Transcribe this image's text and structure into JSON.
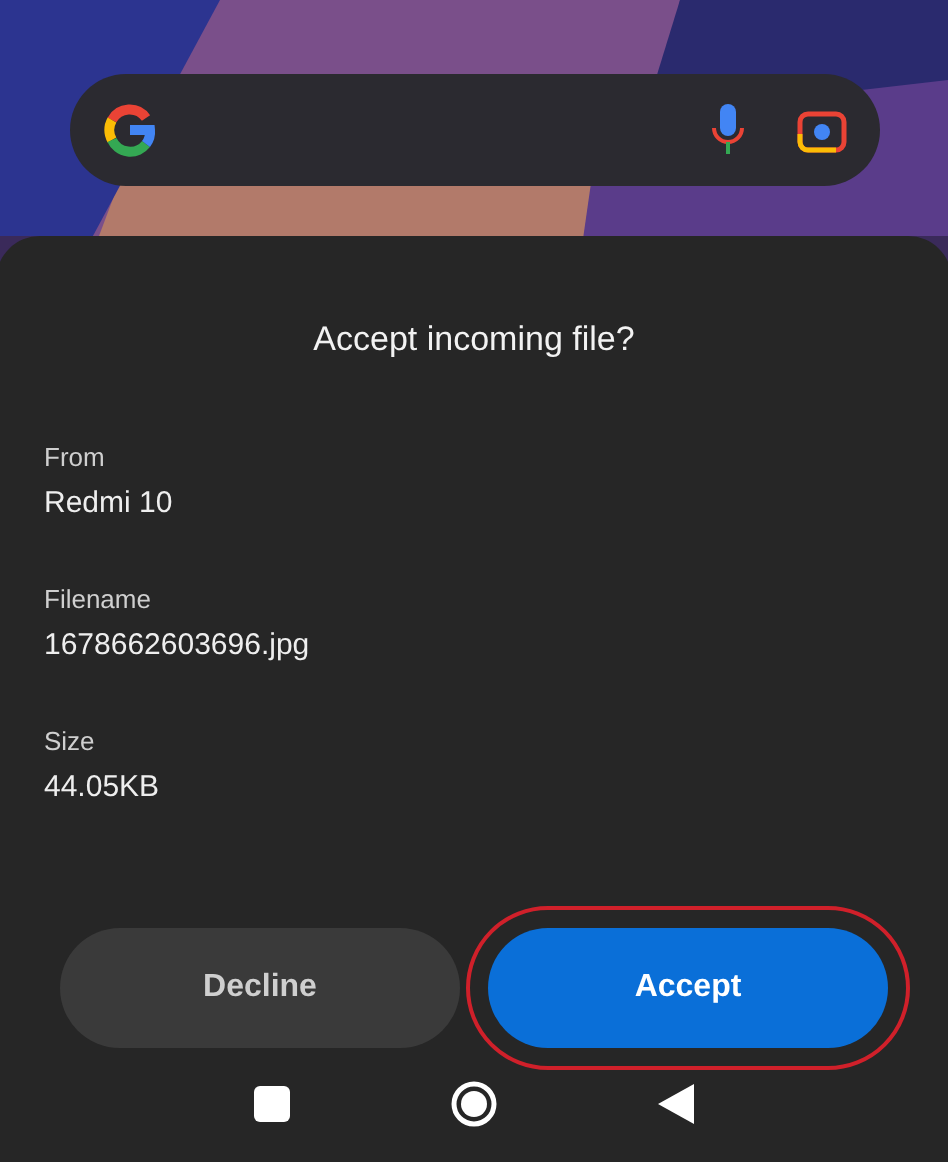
{
  "dialog": {
    "title": "Accept incoming file?",
    "fields": [
      {
        "label": "From",
        "value": "Redmi 10"
      },
      {
        "label": "Filename",
        "value": "1678662603696.jpg"
      },
      {
        "label": "Size",
        "value": "44.05KB"
      }
    ],
    "buttons": [
      {
        "label": "Decline",
        "kind": "secondary",
        "highlighted": false
      },
      {
        "label": "Accept",
        "kind": "primary",
        "highlighted": true
      }
    ]
  }
}
